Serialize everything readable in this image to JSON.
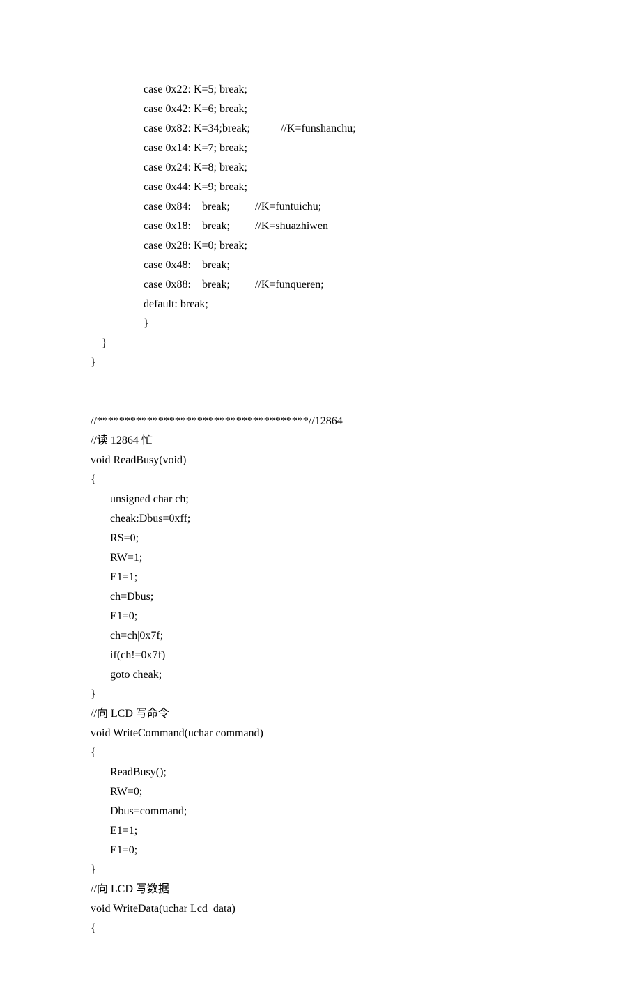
{
  "lines": [
    "                   case 0x22: K=5; break;",
    "                   case 0x42: K=6; break;",
    "                   case 0x82: K=34;break;           //K=funshanchu;",
    "                   case 0x14: K=7; break;",
    "                   case 0x24: K=8; break;",
    "                   case 0x44: K=9; break;",
    "                   case 0x84:    break;         //K=funtuichu;",
    "                   case 0x18:    break;         //K=shuazhiwen",
    "                   case 0x28: K=0; break;",
    "                   case 0x48:    break;",
    "                   case 0x88:    break;         //K=funqueren;",
    "                   default: break;",
    "                   }",
    "    }",
    "}",
    "",
    "",
    "//**************************************//12864",
    "//读 12864 忙",
    "void ReadBusy(void)",
    "{",
    "       unsigned char ch;",
    "       cheak:Dbus=0xff;",
    "       RS=0;",
    "       RW=1;",
    "       E1=1;",
    "       ch=Dbus;",
    "       E1=0;",
    "       ch=ch|0x7f;",
    "       if(ch!=0x7f)",
    "       goto cheak;",
    "}",
    "//向 LCD 写命令",
    "void WriteCommand(uchar command)",
    "{",
    "       ReadBusy();",
    "       RW=0;",
    "       Dbus=command;",
    "       E1=1;",
    "       E1=0;",
    "}",
    "//向 LCD 写数据",
    "void WriteData(uchar Lcd_data)",
    "{"
  ]
}
